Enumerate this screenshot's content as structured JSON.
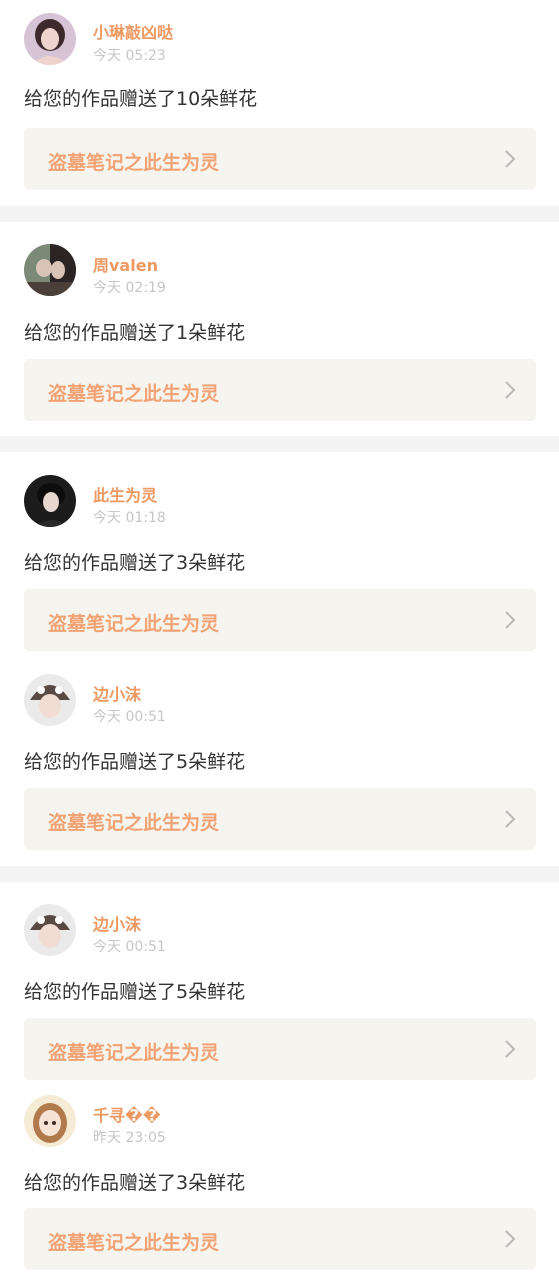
{
  "notifications": [
    {
      "user": "小琳敲凶哒",
      "time": "今天 05:23",
      "message": "给您的作品赠送了10朵鲜花",
      "work_title": "盗墓笔记之此生为灵",
      "avatar_icon": "girl-portrait-avatar",
      "avatar_colors": [
        "#d7c3d6",
        "#3e2a2d",
        "#efd3cf"
      ]
    },
    {
      "user": "周valen",
      "time": "今天 02:19",
      "message": "给您的作品赠送了1朵鲜花",
      "work_title": "盗墓笔记之此生为灵",
      "avatar_icon": "couple-photo-avatar",
      "avatar_colors": [
        "#7b8a76",
        "#2a2424",
        "#d9c4b7"
      ]
    },
    {
      "user": "此生为灵",
      "time": "今天 01:18",
      "message": "给您的作品赠送了3朵鲜花",
      "work_title": "盗墓笔记之此生为灵",
      "avatar_icon": "dark-hair-boy-avatar",
      "avatar_colors": [
        "#1c1c1c",
        "#0d0d0d",
        "#e6d7cf"
      ]
    },
    {
      "user": "边小沫",
      "time": "今天 00:51",
      "message": "给您的作品赠送了5朵鲜花",
      "work_title": "盗墓笔记之此生为灵",
      "avatar_icon": "helmet-girl-avatar",
      "avatar_colors": [
        "#eaeaea",
        "#5a4a44",
        "#f1dcd3"
      ]
    },
    {
      "user": "边小沫",
      "time": "今天 00:51",
      "message": "给您的作品赠送了5朵鲜花",
      "work_title": "盗墓笔记之此生为灵",
      "avatar_icon": "helmet-girl-avatar",
      "avatar_colors": [
        "#eaeaea",
        "#5a4a44",
        "#f1dcd3"
      ]
    },
    {
      "user": "千寻��",
      "time": "昨天 23:05",
      "message": "给您的作品赠送了3朵鲜花",
      "work_title": "盗墓笔记之此生为灵",
      "avatar_icon": "anime-girl-avatar",
      "avatar_colors": [
        "#f6ecd6",
        "#b07a4c",
        "#f7e2d6"
      ]
    }
  ],
  "theme": {
    "username_color": "#ee9962",
    "work_title_color": "#f2a273",
    "time_color": "#c6c6c6",
    "message_color": "#333333",
    "link_background": "#f5f4ee",
    "separator_color": "#f4f4f4"
  },
  "icons": {
    "chevron": "chevron-right-icon"
  }
}
